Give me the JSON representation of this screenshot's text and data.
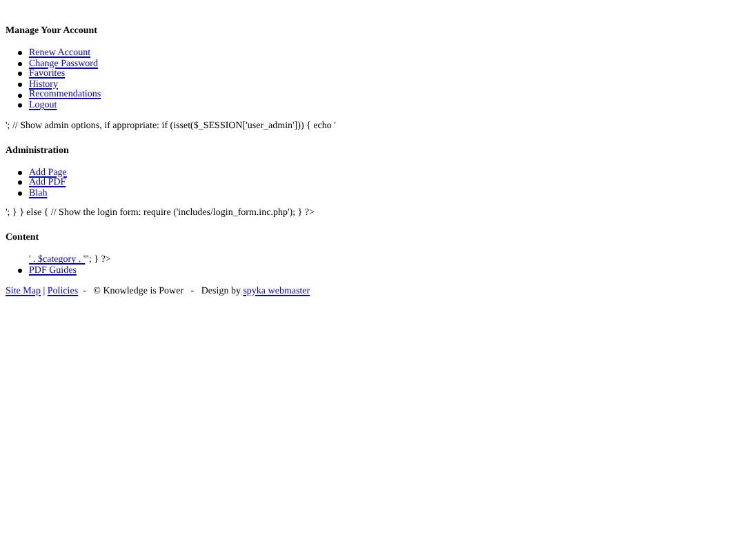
{
  "sections": [
    {
      "heading": "Manage Your Account",
      "items": [
        {
          "label": "Renew Account",
          "bullet": true
        },
        {
          "label": "Change Password",
          "bullet": true
        },
        {
          "label": "Favorites",
          "bullet": true
        },
        {
          "label": "History",
          "bullet": true
        },
        {
          "label": "Recommendations",
          "bullet": true
        },
        {
          "label": "Logout",
          "bullet": true
        }
      ],
      "after": "'; // Show admin options, if appropriate: if (isset($_SESSION['user_admin'])) { echo '"
    },
    {
      "heading": "Administration",
      "items": [
        {
          "label": "Add Page",
          "bullet": true
        },
        {
          "label": "Add PDF",
          "bullet": true
        },
        {
          "label": "Blah",
          "bullet": true
        }
      ],
      "after": "'; } } else { // Show the login form: require ('includes/login_form.inc.php'); } ?>"
    },
    {
      "heading": "Content",
      "items": [
        {
          "label": "' . $category . '",
          "bullet": false,
          "tail": "\"; } ?>"
        },
        {
          "label": "PDF Guides",
          "bullet": true
        }
      ]
    }
  ],
  "footer": [
    {
      "kind": "link",
      "text": "Site Map"
    },
    {
      "kind": "text",
      "text": " | "
    },
    {
      "kind": "link",
      "text": "Policies"
    },
    {
      "kind": "text",
      "text": "  -   © Knowledge is Power   -   Design by "
    },
    {
      "kind": "link",
      "text": "spyka webmaster"
    }
  ]
}
